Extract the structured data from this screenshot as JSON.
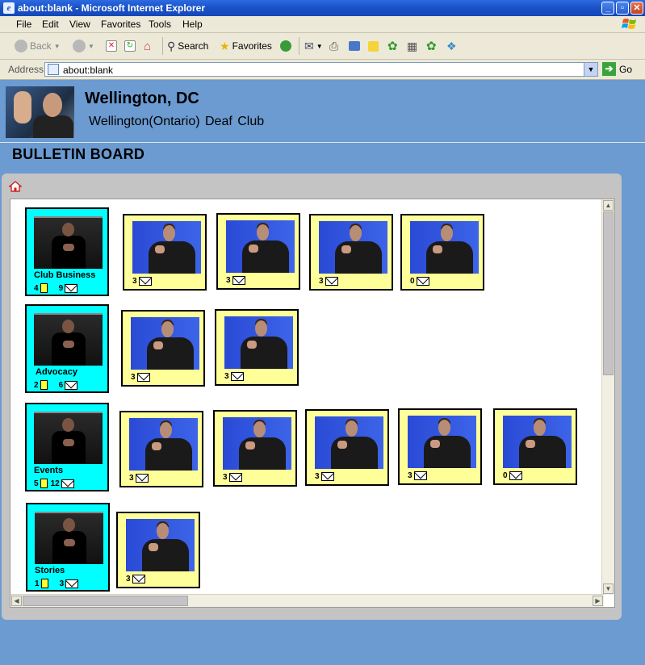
{
  "window": {
    "title": "about:blank - Microsoft Internet Explorer",
    "controls": [
      "minimize",
      "maximize",
      "close"
    ]
  },
  "menu": [
    "File",
    "Edit",
    "View",
    "Favorites",
    "Tools",
    "Help"
  ],
  "toolbar": {
    "back_label": "Back",
    "search_label": "Search",
    "favorites_label": "Favorites"
  },
  "address": {
    "label": "Address",
    "value": "about:blank",
    "go_label": "Go"
  },
  "header": {
    "title": "Wellington, DC",
    "subtitle": "Wellington(Ontario) Deaf Club"
  },
  "board_title": "BULLETIN BOARD",
  "categories": [
    {
      "label": "Club Business",
      "topics": "4",
      "messages": "9",
      "videos": [
        "3",
        "3",
        "3",
        "0"
      ]
    },
    {
      "label": "Advocacy",
      "topics": "2",
      "messages": "6",
      "videos": [
        "3",
        "3"
      ]
    },
    {
      "label": "Events",
      "topics": "5",
      "messages": "12",
      "videos": [
        "3",
        "3",
        "3",
        "3",
        "0"
      ]
    },
    {
      "label": "Stories",
      "topics": "1",
      "messages": "3",
      "videos": [
        "3"
      ]
    }
  ]
}
